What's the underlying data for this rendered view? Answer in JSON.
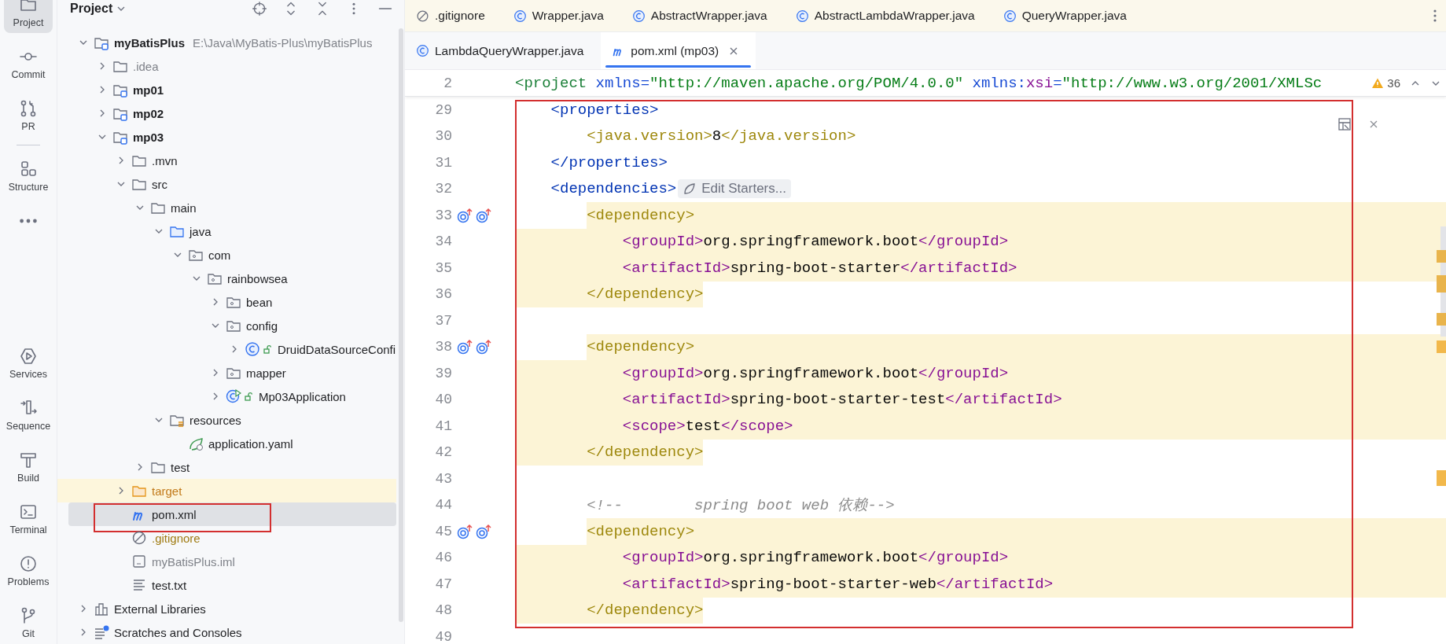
{
  "toolbar": {
    "top": [
      {
        "label": "Project",
        "kind": "project",
        "selected": true
      },
      {
        "label": "Commit",
        "kind": "commit",
        "selected": false
      },
      {
        "label": "PR",
        "kind": "pr",
        "selected": false
      },
      {
        "label": "Structure",
        "kind": "structure",
        "selected": false
      },
      {
        "kind": "more",
        "selected": false
      }
    ],
    "bottom": [
      {
        "label": "Services",
        "kind": "services",
        "selected": false
      },
      {
        "label": "Sequence",
        "kind": "sequence",
        "selected": false
      },
      {
        "label": "Build",
        "kind": "build",
        "selected": false
      },
      {
        "label": "Terminal",
        "kind": "terminal",
        "selected": false
      },
      {
        "label": "Problems",
        "kind": "problems",
        "selected": false
      },
      {
        "label": "Git",
        "kind": "git",
        "selected": false
      }
    ]
  },
  "project_panel": {
    "title": "Project",
    "tree": [
      {
        "label": "myBatisPlus",
        "kind": "module",
        "path": "E:\\Java\\MyBatis-Plus\\myBatisPlus",
        "expanded": true,
        "selected": false,
        "outlined": false,
        "children": [
          {
            "label": ".idea",
            "kind": "config-folder",
            "expanded": false,
            "selected": false,
            "outlined": false
          },
          {
            "label": "mp01",
            "kind": "module",
            "expanded": false,
            "selected": false,
            "outlined": false
          },
          {
            "label": "mp02",
            "kind": "module",
            "expanded": false,
            "selected": false,
            "outlined": false
          },
          {
            "label": "mp03",
            "kind": "module",
            "expanded": true,
            "selected": false,
            "outlined": false,
            "children": [
              {
                "label": ".mvn",
                "kind": "folder",
                "expanded": false,
                "selected": false,
                "outlined": false
              },
              {
                "label": "src",
                "kind": "folder",
                "expanded": true,
                "selected": false,
                "outlined": false,
                "children": [
                  {
                    "label": "main",
                    "kind": "folder",
                    "expanded": true,
                    "selected": false,
                    "outlined": false,
                    "children": [
                      {
                        "label": "java",
                        "kind": "source-folder",
                        "expanded": true,
                        "selected": false,
                        "outlined": false,
                        "children": [
                          {
                            "label": "com",
                            "kind": "package",
                            "expanded": true,
                            "selected": false,
                            "outlined": false,
                            "children": [
                              {
                                "label": "rainbowsea",
                                "kind": "package",
                                "expanded": true,
                                "selected": false,
                                "outlined": false,
                                "children": [
                                  {
                                    "label": "bean",
                                    "kind": "package",
                                    "expanded": false,
                                    "selected": false,
                                    "outlined": false
                                  },
                                  {
                                    "label": "config",
                                    "kind": "package",
                                    "expanded": true,
                                    "selected": false,
                                    "outlined": false,
                                    "children": [
                                      {
                                        "label": "DruidDataSourceConfi",
                                        "kind": "class",
                                        "expanded": false,
                                        "selected": false,
                                        "outlined": false
                                      }
                                    ]
                                  },
                                  {
                                    "label": "mapper",
                                    "kind": "package",
                                    "expanded": false,
                                    "selected": false,
                                    "outlined": false
                                  },
                                  {
                                    "label": "Mp03Application",
                                    "kind": "spring-app",
                                    "expanded": false,
                                    "selected": false,
                                    "outlined": false
                                  }
                                ]
                              }
                            ]
                          }
                        ]
                      },
                      {
                        "label": "resources",
                        "kind": "resources-folder",
                        "expanded": true,
                        "selected": false,
                        "outlined": false,
                        "children": [
                          {
                            "label": "application.yaml",
                            "kind": "yaml",
                            "selected": false,
                            "outlined": false
                          }
                        ]
                      }
                    ]
                  },
                  {
                    "label": "test",
                    "kind": "folder",
                    "expanded": false,
                    "selected": false,
                    "outlined": false
                  }
                ]
              },
              {
                "label": "target",
                "kind": "excluded-folder",
                "expanded": false,
                "selected": false,
                "outlined": false
              },
              {
                "label": "pom.xml",
                "kind": "maven",
                "selected": true,
                "outlined": true
              },
              {
                "label": ".gitignore",
                "kind": "gitignore",
                "selected": false,
                "outlined": false
              },
              {
                "label": "myBatisPlus.iml",
                "kind": "iml",
                "selected": false,
                "outlined": false
              },
              {
                "label": "test.txt",
                "kind": "text",
                "selected": false,
                "outlined": false
              }
            ]
          }
        ]
      },
      {
        "label": "External Libraries",
        "kind": "libraries",
        "expanded": false,
        "selected": false,
        "outlined": false
      },
      {
        "label": "Scratches and Consoles",
        "kind": "scratches",
        "expanded": false,
        "selected": false,
        "outlined": false
      }
    ]
  },
  "editor": {
    "tab_rows": [
      [
        {
          "label": ".gitignore",
          "kind": "gitignore",
          "selected": false
        },
        {
          "label": "Wrapper.java",
          "kind": "class",
          "selected": false
        },
        {
          "label": "AbstractWrapper.java",
          "kind": "class",
          "selected": false
        },
        {
          "label": "AbstractLambdaWrapper.java",
          "kind": "class",
          "selected": false
        },
        {
          "label": "QueryWrapper.java",
          "kind": "class",
          "selected": false
        }
      ],
      [
        {
          "label": "LambdaQueryWrapper.java",
          "kind": "class",
          "selected": false
        },
        {
          "label": "pom.xml (mp03)",
          "kind": "maven",
          "selected": true
        }
      ]
    ],
    "sticky_line": {
      "number": "2",
      "tokens": [
        {
          "t": "<project",
          "kind": "root"
        },
        {
          "t": " xmlns=",
          "kind": "attr"
        },
        {
          "t": "\"http://maven.apache.org/POM/4.0.0\"",
          "kind": "string"
        },
        {
          "t": " xmlns:",
          "kind": "attr"
        },
        {
          "t": "xsi",
          "kind": "ns"
        },
        {
          "t": "=",
          "kind": "attr"
        },
        {
          "t": "\"http://www.w3.org/2001/XMLSc",
          "kind": "string"
        }
      ]
    },
    "warnings": "36",
    "outlined": true,
    "lines": [
      {
        "number": "29",
        "tokens": [
          {
            "t": "    <properties>",
            "kind": "tag"
          }
        ],
        "gutter_icons": false
      },
      {
        "number": "30",
        "tokens": [
          {
            "t": "        <java.version>",
            "kind": "dep"
          },
          {
            "t": "8",
            "kind": "text"
          },
          {
            "t": "</java.version>",
            "kind": "dep"
          }
        ],
        "gutter_icons": false
      },
      {
        "number": "31",
        "tokens": [
          {
            "t": "    </properties>",
            "kind": "tag"
          }
        ],
        "gutter_icons": false
      },
      {
        "number": "32",
        "tokens": [
          {
            "t": "    <dependencies>",
            "kind": "tag"
          }
        ],
        "hint": "Edit Starters...",
        "gutter_icons": false
      },
      {
        "number": "33",
        "tokens": [
          {
            "t": "        <dependency>",
            "kind": "dep"
          }
        ],
        "kind": "block-start",
        "gutter_icons": true
      },
      {
        "number": "34",
        "tokens": [
          {
            "t": "            <groupId>",
            "kind": "child"
          },
          {
            "t": "org.springframework.boot",
            "kind": "text"
          },
          {
            "t": "</groupId>",
            "kind": "child"
          }
        ],
        "kind": "block-middle",
        "gutter_icons": false
      },
      {
        "number": "35",
        "tokens": [
          {
            "t": "            <artifactId>",
            "kind": "child"
          },
          {
            "t": "spring-boot-starter",
            "kind": "text"
          },
          {
            "t": "</artifactId>",
            "kind": "child"
          }
        ],
        "kind": "block-middle",
        "gutter_icons": false
      },
      {
        "number": "36",
        "tokens": [
          {
            "t": "        </dependency>",
            "kind": "dep"
          }
        ],
        "kind": "block-end",
        "gutter_icons": false
      },
      {
        "number": "37",
        "gutter_icons": false
      },
      {
        "number": "38",
        "tokens": [
          {
            "t": "        <dependency>",
            "kind": "dep"
          }
        ],
        "kind": "block-start",
        "gutter_icons": true
      },
      {
        "number": "39",
        "tokens": [
          {
            "t": "            <groupId>",
            "kind": "child"
          },
          {
            "t": "org.springframework.boot",
            "kind": "text"
          },
          {
            "t": "</groupId>",
            "kind": "child"
          }
        ],
        "kind": "block-middle",
        "gutter_icons": false
      },
      {
        "number": "40",
        "tokens": [
          {
            "t": "            <artifactId>",
            "kind": "child"
          },
          {
            "t": "spring-boot-starter-test",
            "kind": "text"
          },
          {
            "t": "</artifactId>",
            "kind": "child"
          }
        ],
        "kind": "block-middle",
        "gutter_icons": false
      },
      {
        "number": "41",
        "tokens": [
          {
            "t": "            <scope>",
            "kind": "child"
          },
          {
            "t": "test",
            "kind": "text"
          },
          {
            "t": "</scope>",
            "kind": "child"
          }
        ],
        "kind": "block-middle",
        "gutter_icons": false
      },
      {
        "number": "42",
        "tokens": [
          {
            "t": "        </dependency>",
            "kind": "dep"
          }
        ],
        "kind": "block-end",
        "gutter_icons": false
      },
      {
        "number": "43",
        "gutter_icons": false
      },
      {
        "number": "44",
        "tokens": [
          {
            "t": "        <!--        spring boot web 依赖-->",
            "kind": "comment"
          }
        ],
        "gutter_icons": false
      },
      {
        "number": "45",
        "tokens": [
          {
            "t": "        <dependency>",
            "kind": "dep"
          }
        ],
        "kind": "block-start",
        "gutter_icons": true
      },
      {
        "number": "46",
        "tokens": [
          {
            "t": "            <groupId>",
            "kind": "child"
          },
          {
            "t": "org.springframework.boot",
            "kind": "text"
          },
          {
            "t": "</groupId>",
            "kind": "child"
          }
        ],
        "kind": "block-middle",
        "gutter_icons": false
      },
      {
        "number": "47",
        "tokens": [
          {
            "t": "            <artifactId>",
            "kind": "child"
          },
          {
            "t": "spring-boot-starter-web",
            "kind": "text"
          },
          {
            "t": "</artifactId>",
            "kind": "child"
          }
        ],
        "kind": "block-middle",
        "gutter_icons": false
      },
      {
        "number": "48",
        "tokens": [
          {
            "t": "        </dependency>",
            "kind": "dep"
          }
        ],
        "kind": "block-end",
        "gutter_icons": false
      },
      {
        "number": "49",
        "gutter_icons": false
      }
    ]
  }
}
